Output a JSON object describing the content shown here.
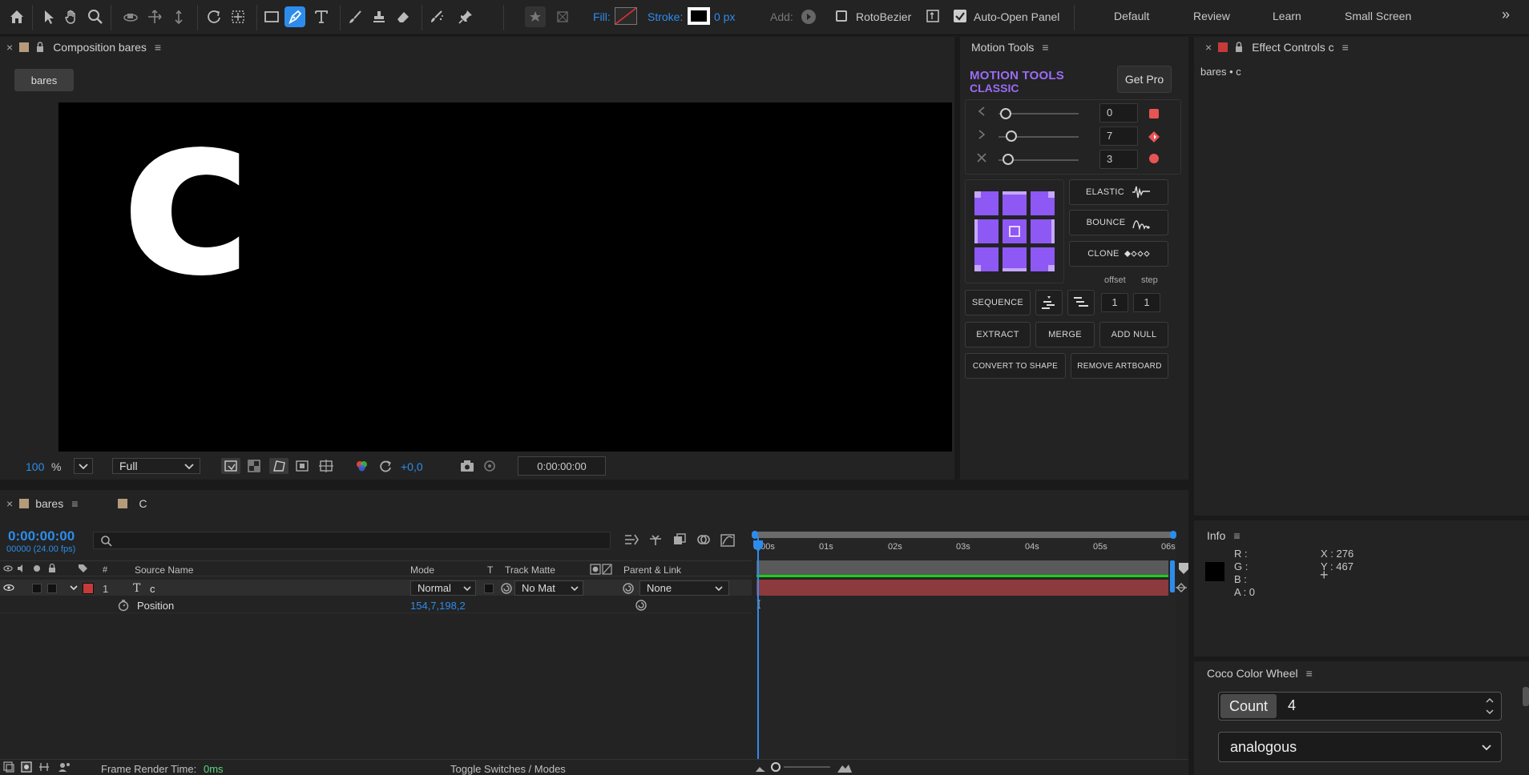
{
  "toolbar": {
    "fill_label": "Fill:",
    "stroke_label": "Stroke:",
    "stroke_px": "0 px",
    "add_label": "Add:",
    "rotobezier": "RotoBezier",
    "auto_open": "Auto-Open Panel",
    "workspaces": [
      "Default",
      "Review",
      "Learn",
      "Small Screen"
    ],
    "more": "»"
  },
  "comp": {
    "title": "Composition bares",
    "tab": "bares",
    "letter": "c",
    "zoom": "100",
    "zoom_unit": "%",
    "resolution": "Full",
    "exposure": "+0,0",
    "timecode": "0:00:00:00"
  },
  "motion_tools": {
    "title": "Motion Tools",
    "brand_line1": "MOTION TOOLS",
    "brand_line2": "CLASSIC",
    "get_pro": "Get Pro",
    "sliders": [
      {
        "value": "0",
        "level": 0.0
      },
      {
        "value": "7",
        "level": 0.08
      },
      {
        "value": "3",
        "level": 0.03
      }
    ],
    "elastic": "ELASTIC",
    "bounce": "BOUNCE",
    "clone": "CLONE",
    "offset_label": "offset",
    "step_label": "step",
    "sequence": "SEQUENCE",
    "offset_value": "1",
    "step_value": "1",
    "extract": "EXTRACT",
    "merge": "MERGE",
    "add_null": "ADD NULL",
    "convert": "CONVERT TO SHAPE",
    "remove_artboard": "REMOVE ARTBOARD"
  },
  "effect_controls": {
    "title": "Effect Controls c",
    "subtitle": "bares • c"
  },
  "timeline": {
    "tab1": "bares",
    "tab2": "C",
    "timecode": "0:00:00:00",
    "frames": "00000 (24.00 fps)",
    "headers": {
      "hash": "#",
      "source": "Source Name",
      "mode": "Mode",
      "t": "T",
      "matte": "Track Matte",
      "parent": "Parent & Link"
    },
    "layer": {
      "num": "1",
      "name": "c",
      "mode": "Normal",
      "matte": "No Mat",
      "parent": "None"
    },
    "property": {
      "name": "Position",
      "value": "154,7,198,2"
    },
    "ruler": [
      "0:00s",
      "01s",
      "02s",
      "03s",
      "04s",
      "05s",
      "06s"
    ],
    "render_label": "Frame Render Time:",
    "render_value": "0ms",
    "toggle": "Toggle Switches / Modes"
  },
  "info": {
    "title": "Info",
    "r": "R :",
    "g": "G :",
    "b": "B :",
    "a": "A :  0",
    "x": "X : 276",
    "y": "Y : 467"
  },
  "coco": {
    "title": "Coco Color Wheel",
    "count_label": "Count",
    "count_value": "4",
    "scheme": "analogous"
  },
  "colors": {
    "accent": "#2d8ceb",
    "purple": "#8e58f5",
    "layer_red": "#c63a3a",
    "bar_red": "#8c3a3e",
    "green": "#19d119"
  }
}
